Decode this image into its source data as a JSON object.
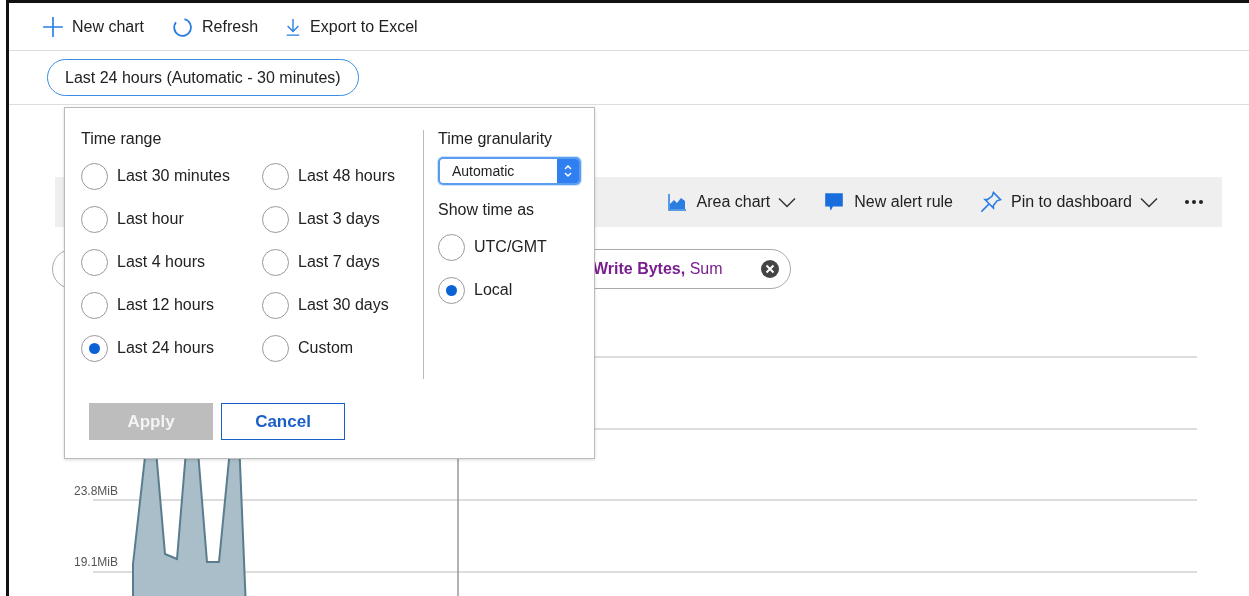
{
  "toolbar": {
    "items": [
      {
        "kind": "new",
        "label": "New chart"
      },
      {
        "kind": "refresh",
        "label": "Refresh"
      },
      {
        "kind": "export",
        "label": "Export to Excel"
      }
    ]
  },
  "time_button": {
    "label": "Last 24 hours (Automatic - 30 minutes)"
  },
  "chart_toolbar": {
    "items": [
      {
        "kind": "area",
        "label": "Area chart",
        "dropdown": true
      },
      {
        "kind": "alert",
        "label": "New alert rule",
        "dropdown": false
      },
      {
        "kind": "pin",
        "label": "Pin to dashboard",
        "dropdown": true
      }
    ]
  },
  "metric_pill": {
    "label": "**Write Bytes,** Sum"
  },
  "chart": {
    "y_labels": [
      "23.8MiB",
      "19.1MiB"
    ]
  },
  "popup": {
    "time_range": {
      "title": "Time range",
      "options": [
        {
          "label": "Last 30 minutes",
          "selected": false
        },
        {
          "label": "Last hour",
          "selected": false
        },
        {
          "label": "Last 4 hours",
          "selected": false
        },
        {
          "label": "Last 12 hours",
          "selected": false
        },
        {
          "label": "Last 24 hours",
          "selected": true
        },
        {
          "label": "Last 48 hours",
          "selected": false
        },
        {
          "label": "Last 3 days",
          "selected": false
        },
        {
          "label": "Last 7 days",
          "selected": false
        },
        {
          "label": "Last 30 days",
          "selected": false
        },
        {
          "label": "Custom",
          "selected": false
        }
      ]
    },
    "granularity": {
      "title": "Time granularity",
      "value": "Automatic"
    },
    "show_time_as": {
      "title": "Show time as",
      "options": [
        {
          "label": "UTC/GMT",
          "selected": false
        },
        {
          "label": "Local",
          "selected": true
        }
      ]
    },
    "buttons": [
      {
        "label": "Apply",
        "disabled": true
      },
      {
        "label": "Cancel",
        "disabled": false
      }
    ]
  }
}
